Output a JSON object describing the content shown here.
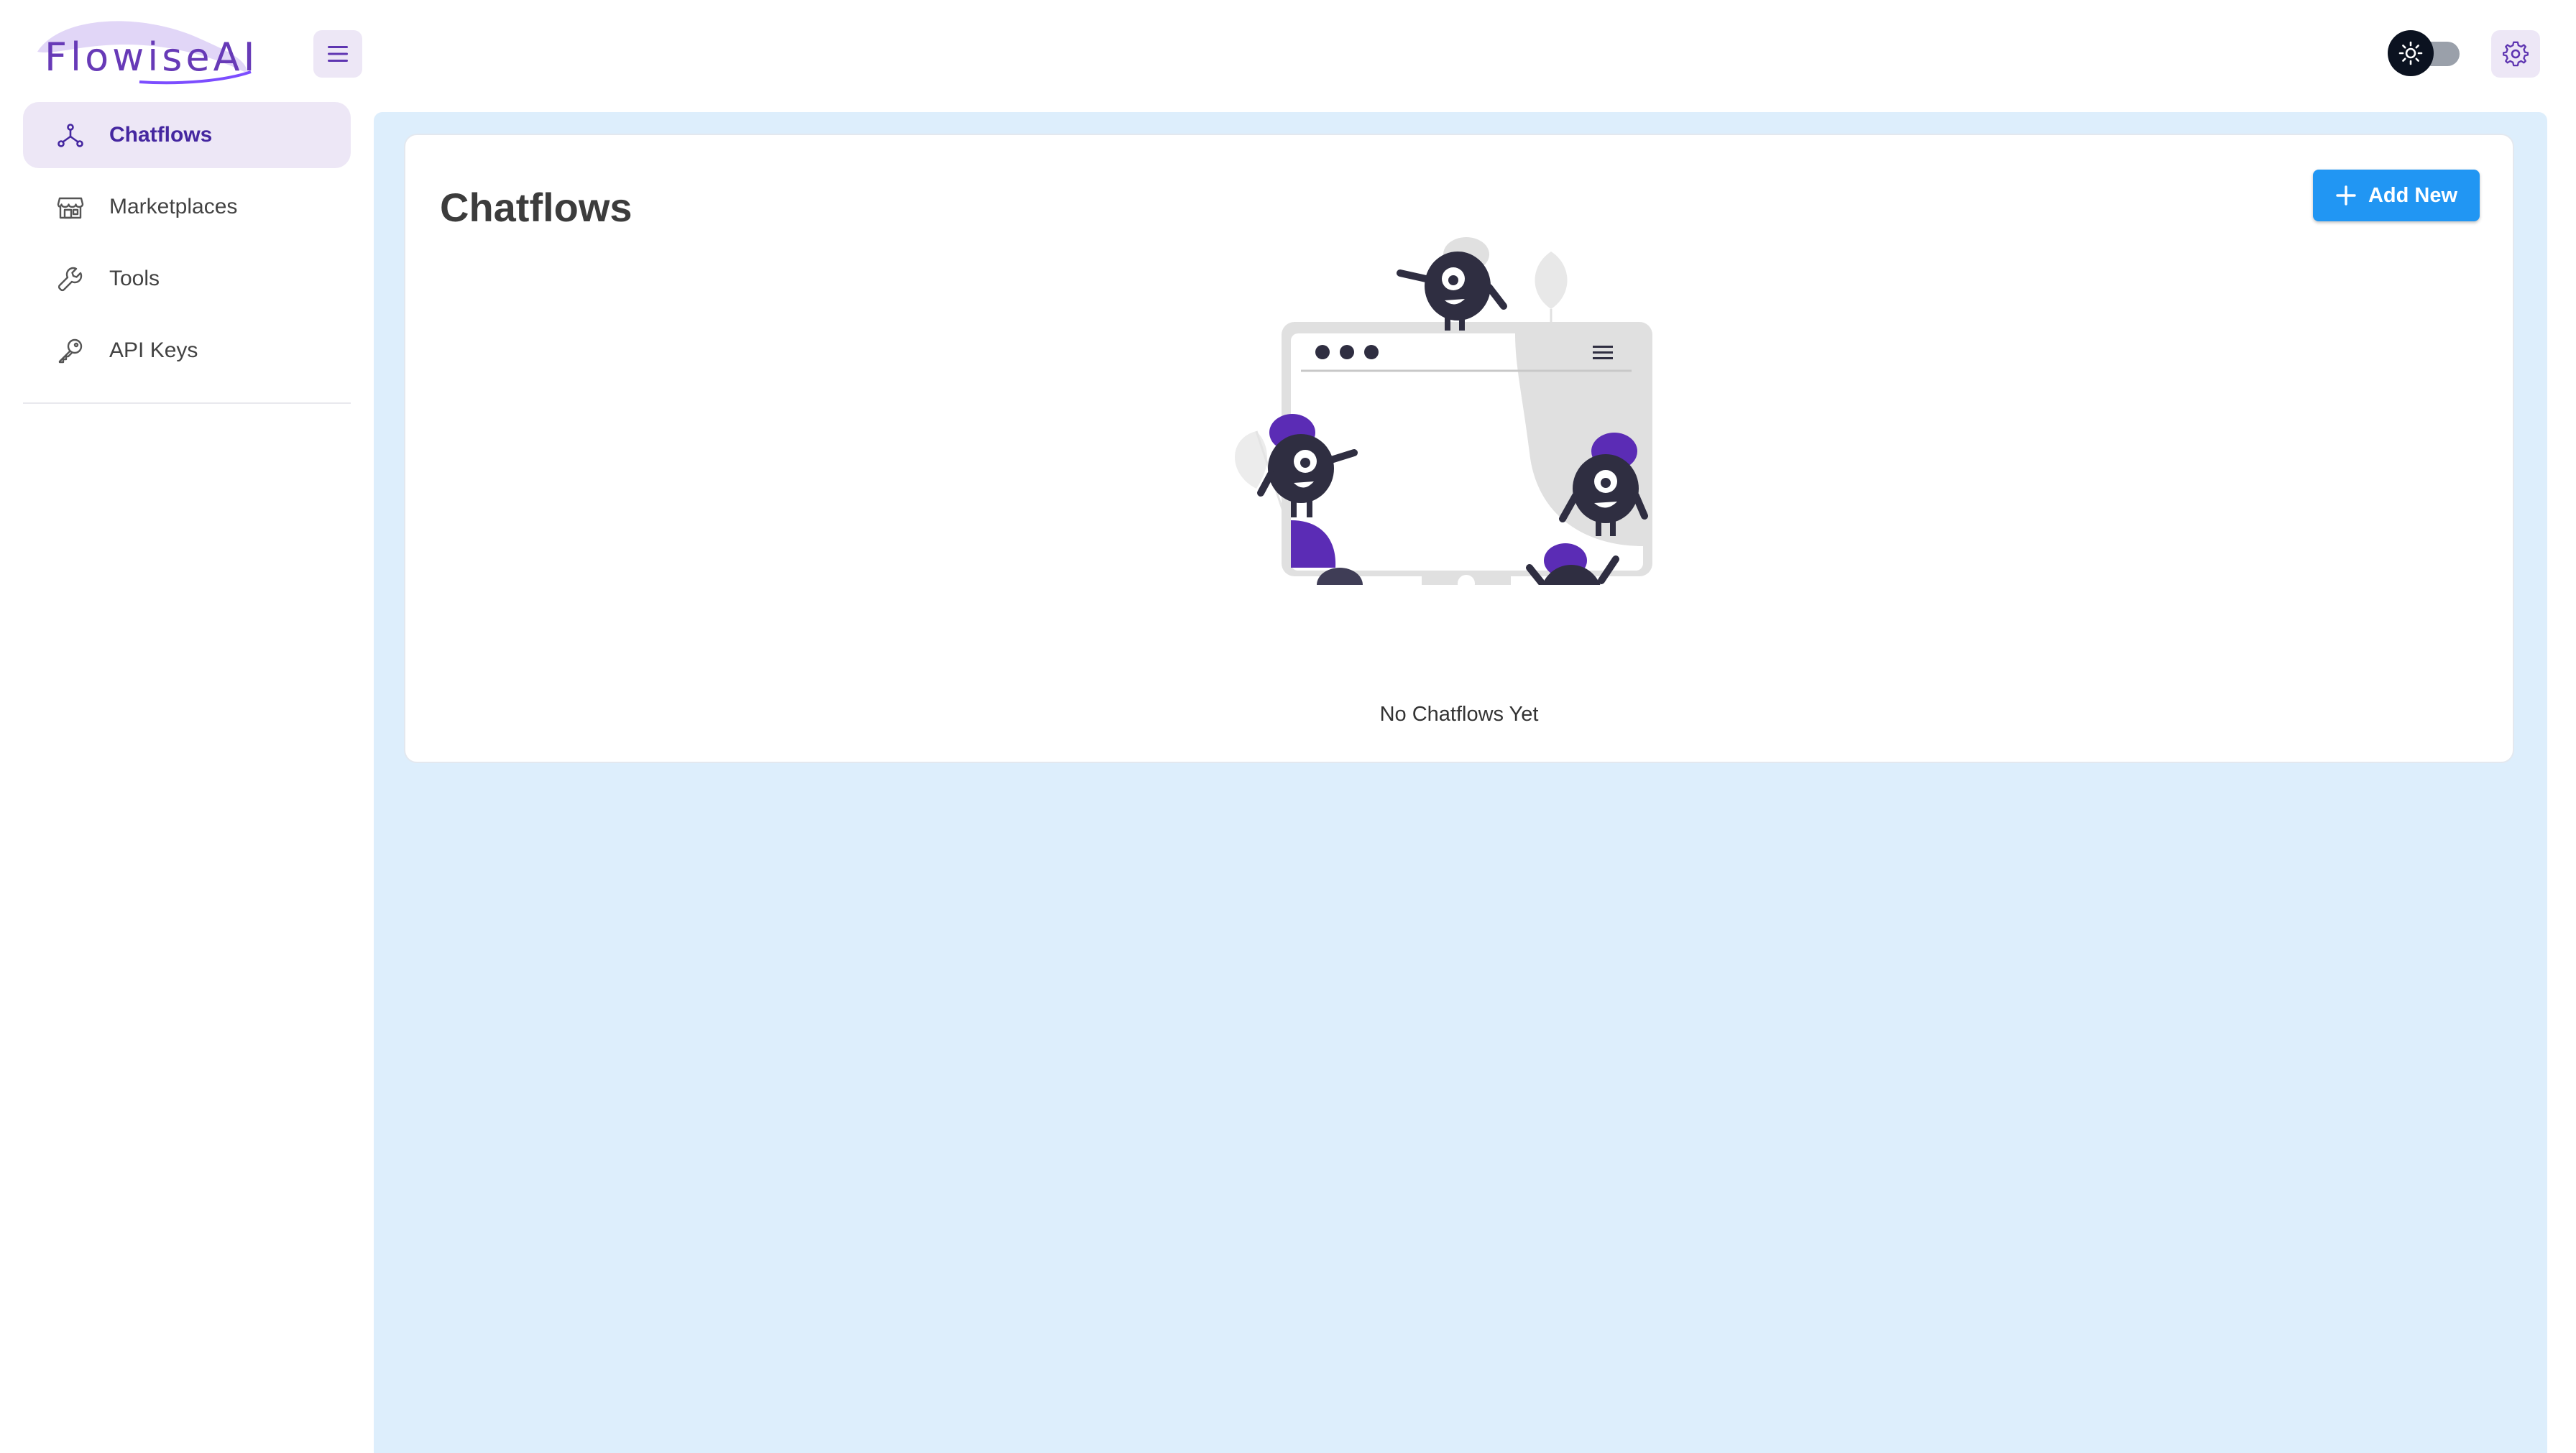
{
  "app": {
    "logo_text": "FlowiseAI",
    "brand_color": "#673ab7"
  },
  "header": {
    "menu_icon": "hamburger-icon",
    "theme_toggle_icon": "sun-icon",
    "settings_icon": "gear-icon"
  },
  "sidebar": {
    "items": [
      {
        "label": "Chatflows",
        "icon": "chatflow-icon",
        "active": true
      },
      {
        "label": "Marketplaces",
        "icon": "store-icon",
        "active": false
      },
      {
        "label": "Tools",
        "icon": "wrench-icon",
        "active": false
      },
      {
        "label": "API Keys",
        "icon": "key-icon",
        "active": false
      }
    ]
  },
  "main": {
    "title": "Chatflows",
    "add_button_label": "Add New",
    "add_button_color": "#2196f3",
    "empty_state_text": "No Chatflows Yet",
    "background_color": "#ddeefc"
  }
}
